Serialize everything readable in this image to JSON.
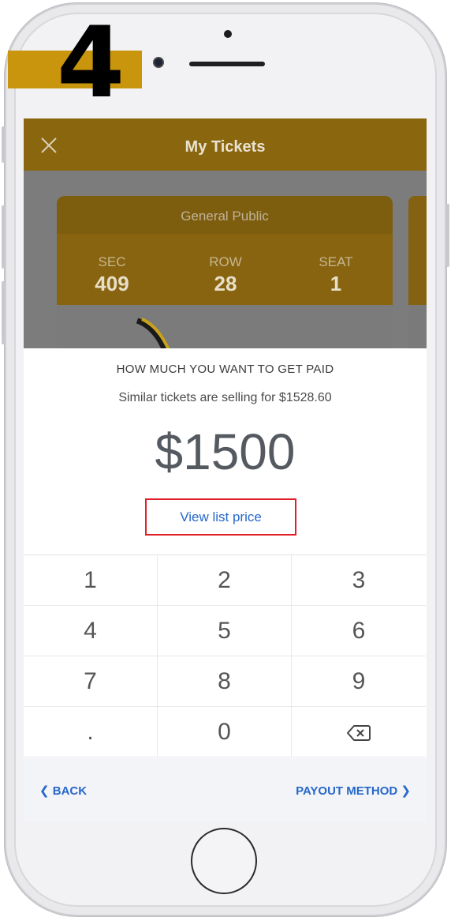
{
  "step_badge": {
    "number": "4"
  },
  "header": {
    "title": "My Tickets"
  },
  "ticket": {
    "type": "General Public",
    "sec_label": "SEC",
    "sec_value": "409",
    "row_label": "ROW",
    "row_value": "28",
    "seat_label": "SEAT",
    "seat_value": "1"
  },
  "pricing": {
    "prompt": "HOW MUCH YOU WANT TO GET PAID",
    "similar_text": "Similar tickets are selling for $1528.60",
    "amount": "$1500",
    "view_list_price": "View list price"
  },
  "keypad": {
    "k1": "1",
    "k2": "2",
    "k3": "3",
    "k4": "4",
    "k5": "5",
    "k6": "6",
    "k7": "7",
    "k8": "8",
    "k9": "9",
    "dot": ".",
    "k0": "0",
    "backspace_icon": "backspace-icon"
  },
  "footer": {
    "back": "BACK",
    "payout": "PAYOUT METHOD"
  },
  "colors": {
    "header_gold": "#8a660f",
    "step_band": "#c9950c",
    "link_blue": "#2667c9",
    "highlight_red": "#e01e27"
  }
}
